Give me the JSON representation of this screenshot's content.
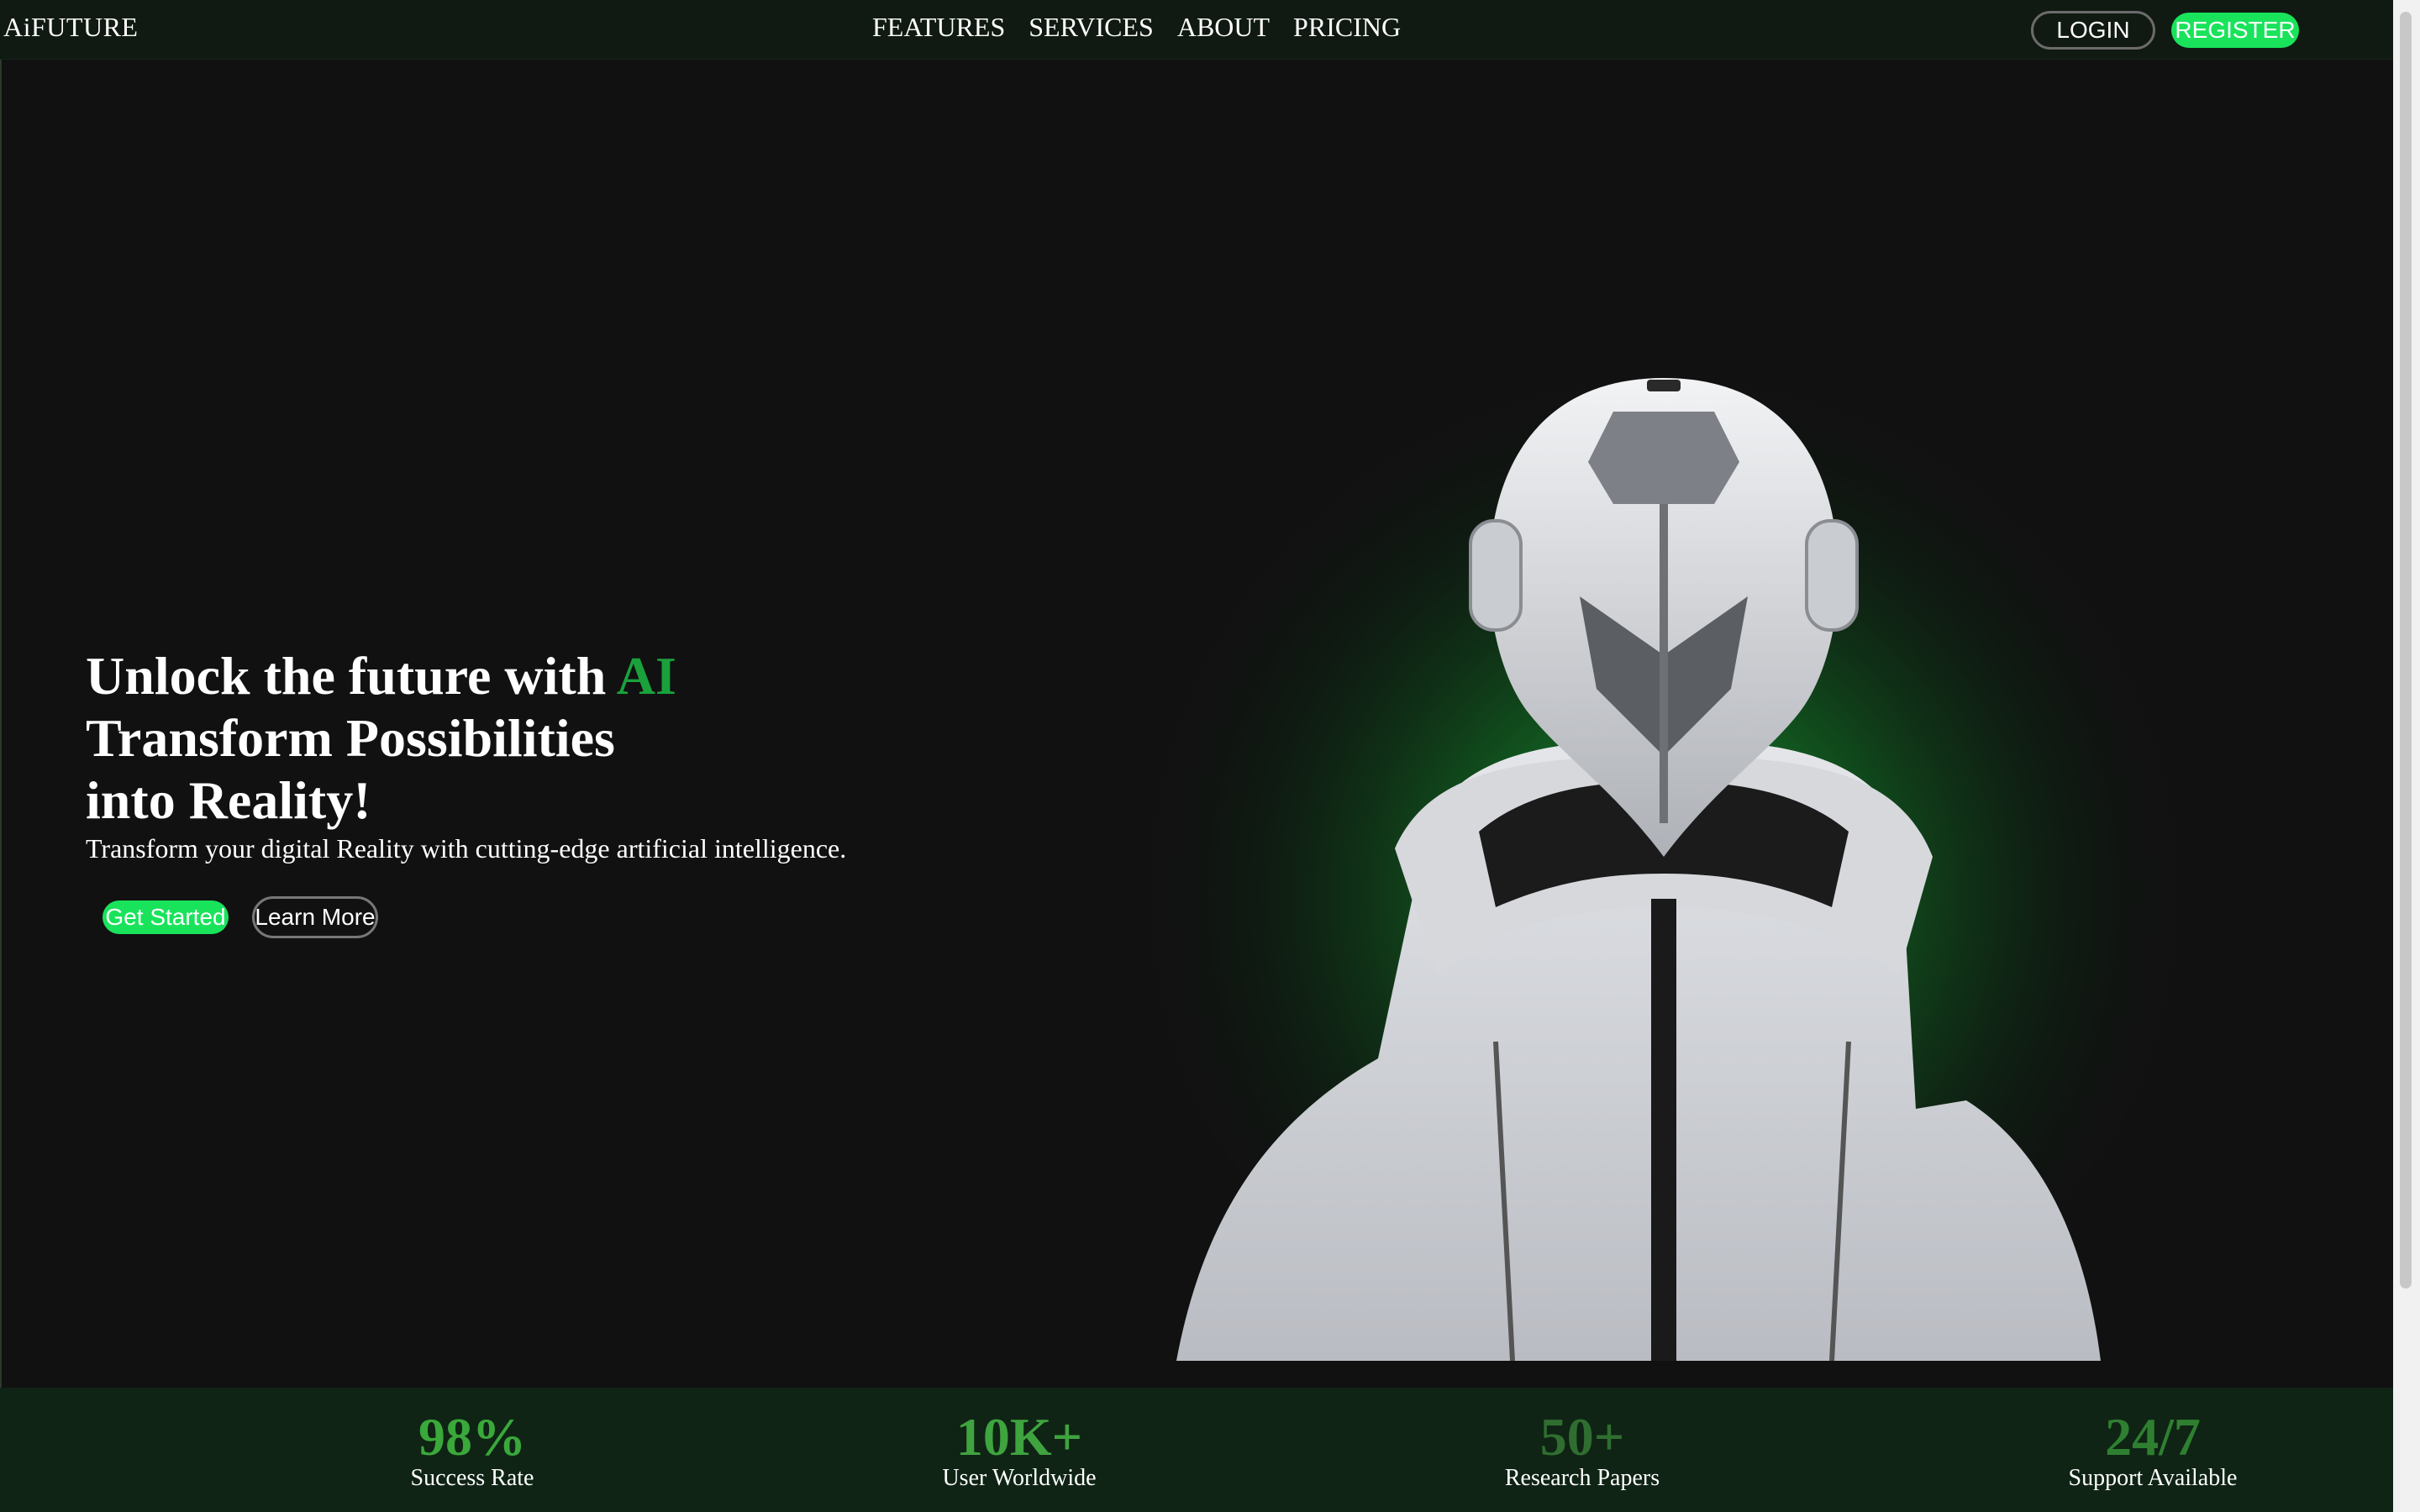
{
  "header": {
    "brand": "AiFUTURE",
    "nav": [
      "FEATURES",
      "SERVICES",
      "ABOUT",
      "PRICING"
    ],
    "login_label": "LOGIN",
    "register_label": "REGISTER"
  },
  "hero": {
    "title_line1": "Unlock the future with ",
    "title_accent": "AI",
    "title_line2": "Transform Possibilities",
    "title_line3": "into Reality!",
    "subtitle": "Transform your digital Reality with cutting-edge artificial intelligence.",
    "get_started_label": "Get Started",
    "learn_more_label": "Learn More",
    "image_subject": "helmeted-figure-in-white-hoodie"
  },
  "stats": [
    {
      "value": "98%",
      "label": "Success Rate",
      "color": "#3aa83a"
    },
    {
      "value": "10K+",
      "label": "User Worldwide",
      "color": "#3fa33f"
    },
    {
      "value": "50+",
      "label": "Research Papers",
      "color": "#2f6e30"
    },
    {
      "value": "24/7",
      "label": "Support Available",
      "color": "#2f7f31"
    }
  ],
  "colors": {
    "accent": "#19e35b",
    "accent_text": "#1aa13c",
    "background": "#111111",
    "stats_bg": "#0f2415"
  }
}
